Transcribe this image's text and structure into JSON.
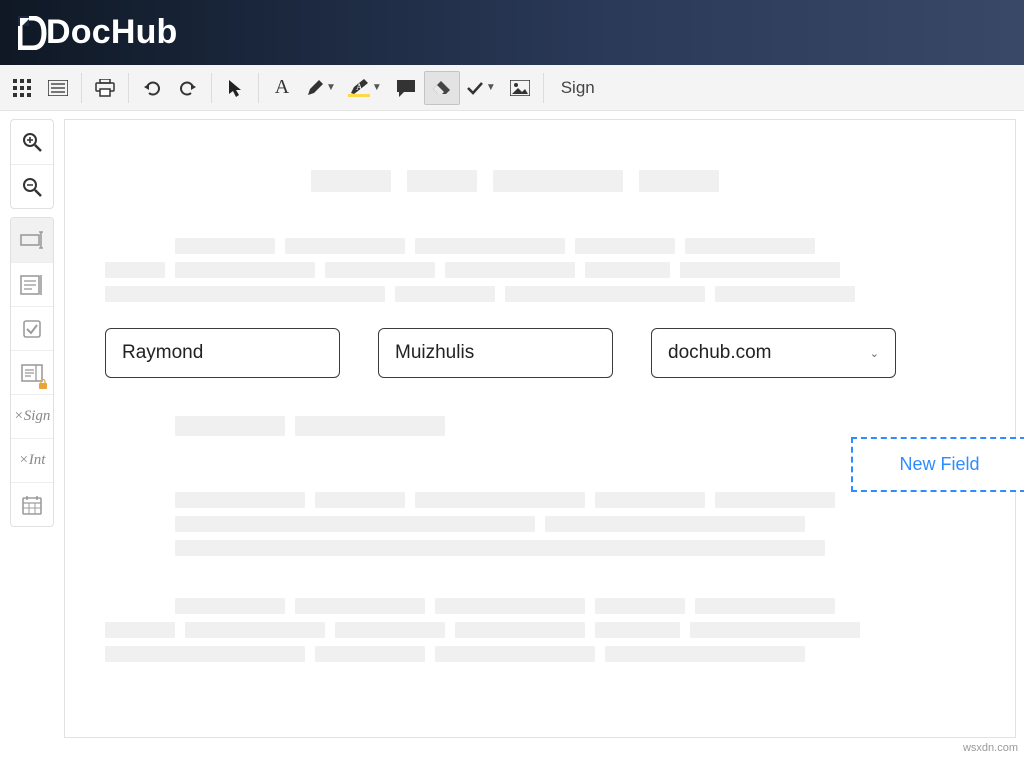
{
  "brand": "DocHub",
  "toolbar": {
    "sign_label": "Sign"
  },
  "fields": {
    "first_name": "Raymond",
    "last_name": "Muizhulis",
    "dropdown_value": "dochub.com"
  },
  "floating": {
    "new_field_label": "New Field"
  },
  "sidebar": {
    "sign_item": "Sign",
    "initials_item": "Int"
  },
  "watermark": "wsxdn.com"
}
